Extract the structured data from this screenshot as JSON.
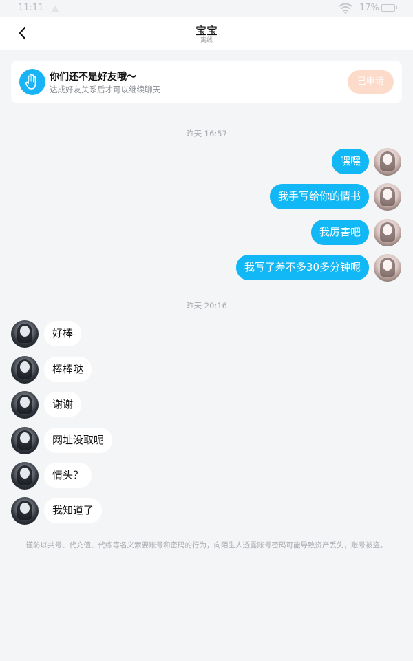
{
  "status_bar": {
    "time": "11:11",
    "battery_percent": "17%"
  },
  "nav": {
    "title": "宝宝",
    "subtitle": "离线"
  },
  "friend_notice": {
    "title": "你们还不是好友哦～",
    "subtitle": "达成好友关系后才可以继续聊天",
    "button_label": "已申请"
  },
  "timestamps": {
    "first": "昨天 16:57",
    "second": "昨天 20:16"
  },
  "sent_messages": [
    "嘿嘿",
    "我手写给你的情书",
    "我厉害吧",
    "我写了差不多30多分钟呢"
  ],
  "received_messages": [
    "好棒",
    "棒棒哒",
    "谢谢",
    "网址没取呢",
    "情头？",
    "我知道了"
  ],
  "disclaimer": "谨防以共号、代充值、代练等名义索要账号和密码的行为，向陌生人透露账号密码可能导致资产丢失，账号被盗。",
  "colors": {
    "sent_bubble": "#12b7f5",
    "received_bubble": "#ffffff",
    "applied_button": "#fddbcb",
    "background": "#f4f5f7"
  }
}
